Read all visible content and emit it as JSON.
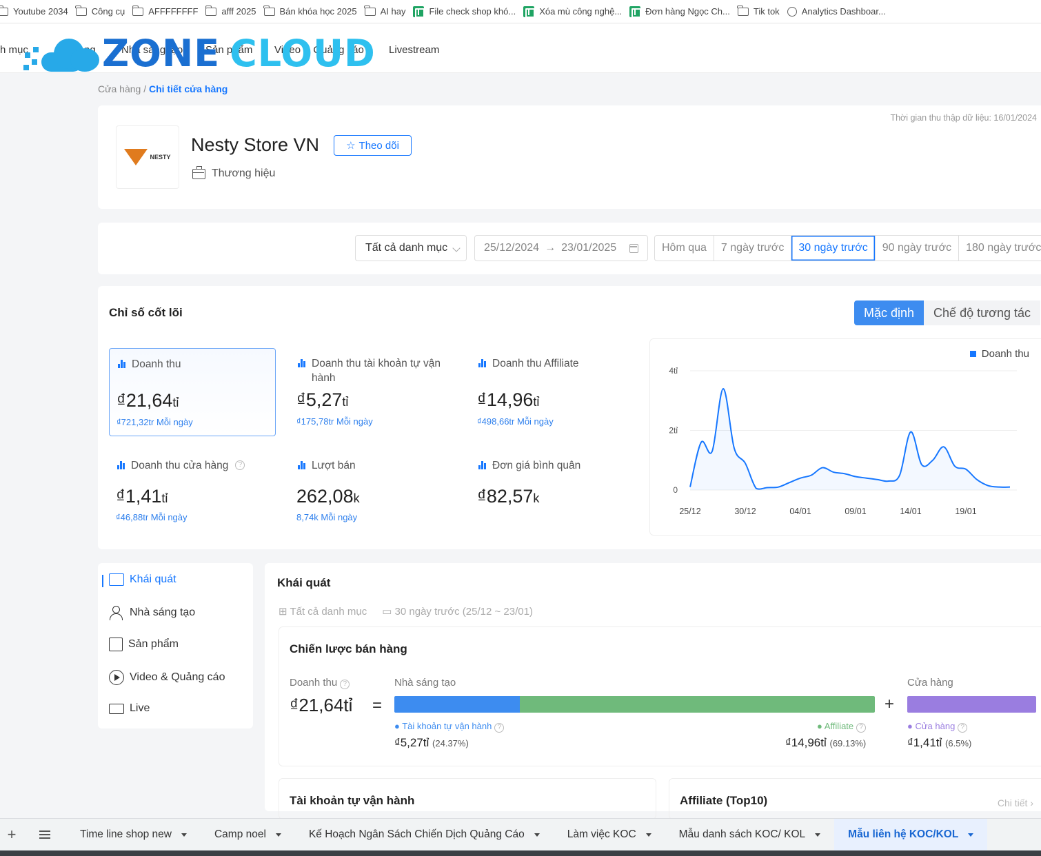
{
  "bookmarks": [
    {
      "label": "Youtube 2034",
      "icon": "folder-icon"
    },
    {
      "label": "Công cụ",
      "icon": "folder-icon"
    },
    {
      "label": "AFFFFFFFF",
      "icon": "folder-icon"
    },
    {
      "label": "afff 2025",
      "icon": "folder-icon"
    },
    {
      "label": "Bán khóa học 2025",
      "icon": "folder-icon"
    },
    {
      "label": "AI hay",
      "icon": "folder-icon"
    },
    {
      "label": "File check shop khó...",
      "icon": "sheets-icon"
    },
    {
      "label": "Xóa mù công nghệ...",
      "icon": "sheets-icon"
    },
    {
      "label": "Đơn hàng Ngọc Ch...",
      "icon": "sheets-icon"
    },
    {
      "label": "Tik tok",
      "icon": "folder-icon"
    },
    {
      "label": "Analytics Dashboar...",
      "icon": "analytics-icon"
    }
  ],
  "nav": {
    "items": [
      "h mục",
      "ng",
      "Nhà sáng tạo",
      "Sản phẩm",
      "Video & Quảng cáo",
      "Livestream"
    ],
    "logo_word1": "ZONE",
    "logo_word2": "CLOUD"
  },
  "breadcrumb": {
    "parent": "Cửa hàng",
    "sep": " / ",
    "current": "Chi tiết cửa hàng"
  },
  "store": {
    "logo_text": "NESTY",
    "name": "Nesty Store VN",
    "follow_label": "Theo dõi",
    "type": "Thương hiệu",
    "data_time": "Thời gian thu thập dữ liệu: 16/01/2024"
  },
  "filters": {
    "category": "Tất cả danh mục",
    "date_start": "25/12/2024",
    "date_end": "23/01/2025",
    "periods": [
      "Hôm qua",
      "7 ngày trước",
      "30 ngày trước",
      "90 ngày trước",
      "180 ngày trước"
    ],
    "active_period": "30 ngày trước"
  },
  "core": {
    "title": "Chỉ số cốt lõi",
    "mode_default": "Mặc định",
    "mode_interactive": "Chế độ tương tác",
    "metrics": [
      {
        "label": "Doanh thu",
        "value": "₫21,64",
        "unit": "tỉ",
        "sub": "₫721,32tr Mỗi ngày"
      },
      {
        "label": "Doanh thu tài khoản tự vận hành",
        "value": "₫5,27",
        "unit": "tỉ",
        "sub": "₫175,78tr Mỗi ngày"
      },
      {
        "label": "Doanh thu Affiliate",
        "value": "₫14,96",
        "unit": "tỉ",
        "sub": "₫498,66tr Mỗi ngày"
      },
      {
        "label": "Doanh thu cửa hàng",
        "value": "₫1,41",
        "unit": "tỉ",
        "sub": "₫46,88tr Mỗi ngày"
      },
      {
        "label": "Lượt bán",
        "value": "262,08",
        "unit": "k",
        "sub": "8,74k Mỗi ngày"
      },
      {
        "label": "Đơn giá bình quân",
        "value": "₫82,57",
        "unit": "k",
        "sub": ""
      }
    ]
  },
  "chart_data": {
    "type": "area",
    "series": [
      {
        "name": "Doanh thu",
        "color": "#1677ff"
      }
    ],
    "x": [
      "25/12",
      "26/12",
      "27/12",
      "28/12",
      "29/12",
      "30/12",
      "31/12",
      "01/01",
      "02/01",
      "03/01",
      "04/01",
      "05/01",
      "06/01",
      "07/01",
      "08/01",
      "09/01",
      "10/01",
      "11/01",
      "12/01",
      "13/01",
      "14/01",
      "15/01",
      "16/01",
      "17/01",
      "18/01",
      "19/01",
      "20/01",
      "21/01",
      "22/01",
      "23/01"
    ],
    "values": [
      0.1,
      1.6,
      1.3,
      3.4,
      1.4,
      0.9,
      0.05,
      0.08,
      0.1,
      0.25,
      0.4,
      0.5,
      0.75,
      0.6,
      0.55,
      0.45,
      0.4,
      0.35,
      0.3,
      0.5,
      1.95,
      0.85,
      1.0,
      1.45,
      0.8,
      0.7,
      0.35,
      0.15,
      0.1,
      0.1
    ],
    "xticks": [
      "25/12",
      "30/12",
      "04/01",
      "09/01",
      "14/01",
      "19/01"
    ],
    "yticks": [
      "0",
      "2tỉ",
      "4tỉ"
    ],
    "ylim": [
      0,
      4
    ],
    "legend": "top-right"
  },
  "overview_menu": {
    "items": [
      "Khái quát",
      "Nhà sáng tạo",
      "Sản phẩm",
      "Video & Quảng cáo",
      "Live"
    ]
  },
  "overview": {
    "title": "Khái quát",
    "filter_category": "Tất cả danh mục",
    "filter_period": "30 ngày trước (25/12 ~ 23/01)",
    "strategy": {
      "title": "Chiến lược bán hàng",
      "revenue_label": "Doanh thu",
      "revenue_value": "₫21,64tỉ",
      "eq": "=",
      "plus": "+",
      "creator_label": "Nhà sáng tạo",
      "shop_label": "Cửa hàng",
      "self_operated": {
        "label": "Tài khoản tự vận hành",
        "value": "₫5,27tỉ",
        "pct": "(24.37%)",
        "share": 24.37,
        "color": "#3d8cf0"
      },
      "affiliate": {
        "label": "Affiliate",
        "value": "₫14,96tỉ",
        "pct": "(69.13%)",
        "share": 69.13,
        "color": "#6fba7b"
      },
      "shop": {
        "label": "Cửa hàng",
        "value": "₫1,41tỉ",
        "pct": "(6.5%)",
        "share": 6.5,
        "color": "#9a7de0"
      }
    },
    "self_operated_title": "Tài khoản tự vận hành",
    "affiliate_title": "Affiliate (Top10)",
    "detail_link": "Chi tiết"
  },
  "sheet_tabs": {
    "tabs": [
      "Time line shop new",
      "Camp noel",
      "Kế Hoạch Ngân Sách Chiến Dịch Quảng Cáo",
      "Làm việc KOC",
      "Mẫu danh sách KOC/ KOL",
      "Mẫu liên hệ KOC/KOL"
    ],
    "active": "Mẫu liên hệ KOC/KOL"
  }
}
